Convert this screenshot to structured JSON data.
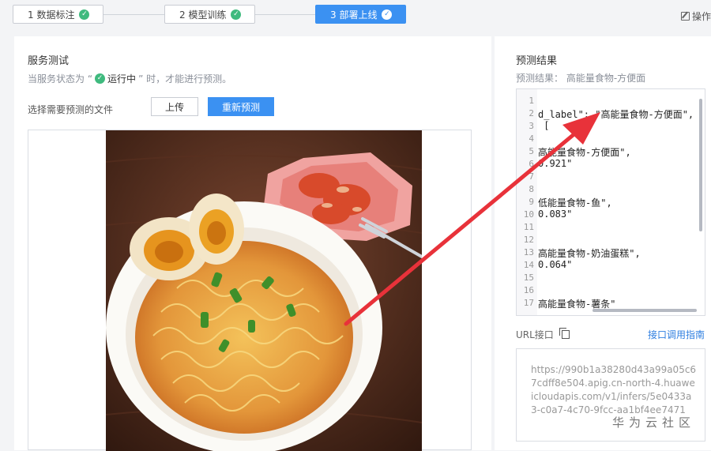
{
  "stepper": {
    "steps": [
      {
        "label": "1 数据标注",
        "done": true
      },
      {
        "label": "2 模型训练",
        "done": true
      },
      {
        "label": "3 部署上线",
        "done": true,
        "active": true
      }
    ],
    "ops_label": "操作"
  },
  "test": {
    "title": "服务测试",
    "hint_prefix": "当服务状态为 “",
    "hint_status": "运行中",
    "hint_suffix": "” 时，才能进行预测。",
    "file_label": "选择需要预测的文件",
    "upload_label": "上传",
    "repredict_label": "重新预测"
  },
  "result": {
    "title": "预测结果",
    "subtitle": "预测结果： 高能量食物-方便面",
    "line_numbers": [
      "1",
      "2",
      "3",
      "4",
      "5",
      "6",
      "7",
      "8",
      "9",
      "10",
      "11",
      "12",
      "13",
      "14",
      "15",
      "16",
      "17"
    ],
    "code_lines": [
      "",
      "d_label\": \"高能量食物-方便面\",",
      " [",
      "",
      "高能量食物-方便面\",",
      "0.921\"",
      "",
      "",
      "低能量食物-鱼\",",
      "0.083\"",
      "",
      "",
      "高能量食物-奶油蛋糕\",",
      "0.064\"",
      "",
      "",
      "高能量食物-薯条\""
    ]
  },
  "url": {
    "label": "URL接口",
    "api_guide": "接口调用指南",
    "value": "https://990b1a38280d43a99a05c67cdff8e504.apig.cn-north-4.huaweicloudapis.com/v1/infers/5e0433a3-c0a7-4c70-9fcc-aa1bf4ee7471"
  },
  "watermark": "华为云社区",
  "colors": {
    "accent": "#3b91f2",
    "success": "#3fba7e",
    "annotation_arrow": "#e8323a"
  }
}
